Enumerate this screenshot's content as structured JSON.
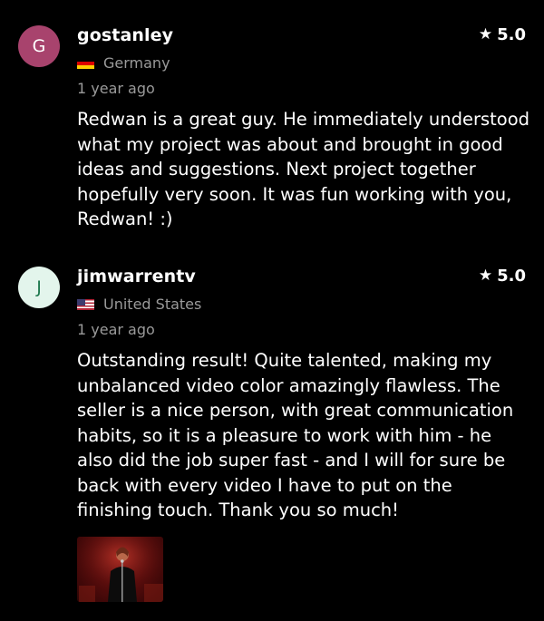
{
  "reviews": [
    {
      "avatar_letter": "G",
      "avatar_color": "#a8436d",
      "avatar_text_color": "#ffffff",
      "username": "gostanley",
      "rating": "5.0",
      "country": "Germany",
      "flag": "germany-flag-icon",
      "date": "1 year ago",
      "text": "Redwan is a great guy. He immediately understood what my project was about and brought in good ideas and suggestions. Next project together hopefully very soon. It was fun working with you, Redwan! :)"
    },
    {
      "avatar_letter": "J",
      "avatar_color": "#e3f5ec",
      "avatar_text_color": "#1f7a4f",
      "username": "jimwarrentv",
      "rating": "5.0",
      "country": "United States",
      "flag": "united-states-flag-icon",
      "date": "1 year ago",
      "text": "Outstanding result! Quite talented, making my unbalanced video color amazingly flawless. The seller is a nice person, with great communication habits, so it is a pleasure to work with him - he also did the job super fast - and I will for sure be back with every video I have to put on the finishing touch. Thank you so much!",
      "attachment": "review-attachment-thumbnail"
    }
  ],
  "icons": {
    "star": "star-icon"
  }
}
